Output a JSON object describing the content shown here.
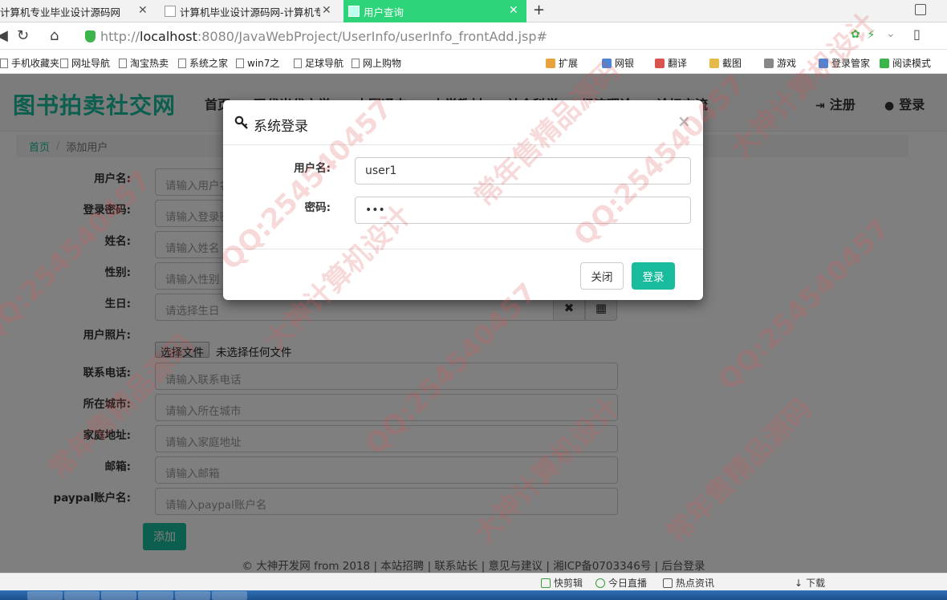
{
  "browser": {
    "tabs": [
      {
        "label": "计算机专业毕业设计源码网",
        "active": false
      },
      {
        "label": "计算机毕业设计源码网-计算机专",
        "active": false
      },
      {
        "label": "用户查询",
        "active": true
      }
    ],
    "tab_close": "✕",
    "new_tab": "+",
    "url_prefix": "http://",
    "url_host": "localhost",
    "url_rest": ":8080/JavaWebProject/UserInfo/userInfo_frontAdd.jsp#",
    "bookmarks_left": [
      "手机收藏夹",
      "网址导航",
      "淘宝热卖",
      "系统之家",
      "win7之",
      "足球导航",
      "网上购物"
    ],
    "bookmarks_right": [
      "扩展",
      "网银",
      "翻译",
      "截图",
      "游戏",
      "登录管家",
      "阅读模式"
    ]
  },
  "site": {
    "brand": "图书拍卖社交网",
    "nav": [
      "首页",
      "现代当代文学",
      "中国通史",
      "大学教材",
      "社会科学",
      "经济理论",
      "论坛交流"
    ],
    "register": "注册",
    "login": "登录",
    "breadcrumb": {
      "home": "首页",
      "separator": "/",
      "current": "添加用户"
    }
  },
  "form": {
    "fields": [
      {
        "label": "用户名:",
        "placeholder": "请输入用户名"
      },
      {
        "label": "登录密码:",
        "placeholder": "请输入登录密码"
      },
      {
        "label": "姓名:",
        "placeholder": "请输入姓名"
      },
      {
        "label": "性别:",
        "placeholder": "请输入性别"
      },
      {
        "label": "生日:",
        "placeholder": "请选择生日"
      }
    ],
    "photo_label": "用户照片:",
    "file_button": "选择文件",
    "file_status": "未选择任何文件",
    "fields2": [
      {
        "label": "联系电话:",
        "placeholder": "请输入联系电话"
      },
      {
        "label": "所在城市:",
        "placeholder": "请输入所在城市"
      },
      {
        "label": "家庭地址:",
        "placeholder": "请输入家庭地址"
      },
      {
        "label": "邮箱:",
        "placeholder": "请输入邮箱"
      },
      {
        "label": "paypal账户名:",
        "placeholder": "请输入paypal账户名"
      }
    ],
    "clear_icon": "✖",
    "calendar_icon": "▦",
    "submit": "添加"
  },
  "footer": "© 大神开发网 from 2018 | 本站招聘 | 联系站长 | 意见与建议 | 湘ICP备0703346号 | 后台登录",
  "modal": {
    "title": "系统登录",
    "close": "×",
    "username_label": "用户名:",
    "username_value": "user1",
    "password_label": "密码:",
    "password_value": "•••",
    "cancel": "关闭",
    "submit": "登录"
  },
  "statusbar": [
    "快剪辑",
    "今日直播",
    "热点资讯",
    "下载"
  ],
  "watermark": [
    "QQ:254540457",
    "常年售精品源码",
    "大神计算机设计"
  ],
  "colors": {
    "accent": "#18bc9c",
    "active_tab": "#2ed47a"
  }
}
